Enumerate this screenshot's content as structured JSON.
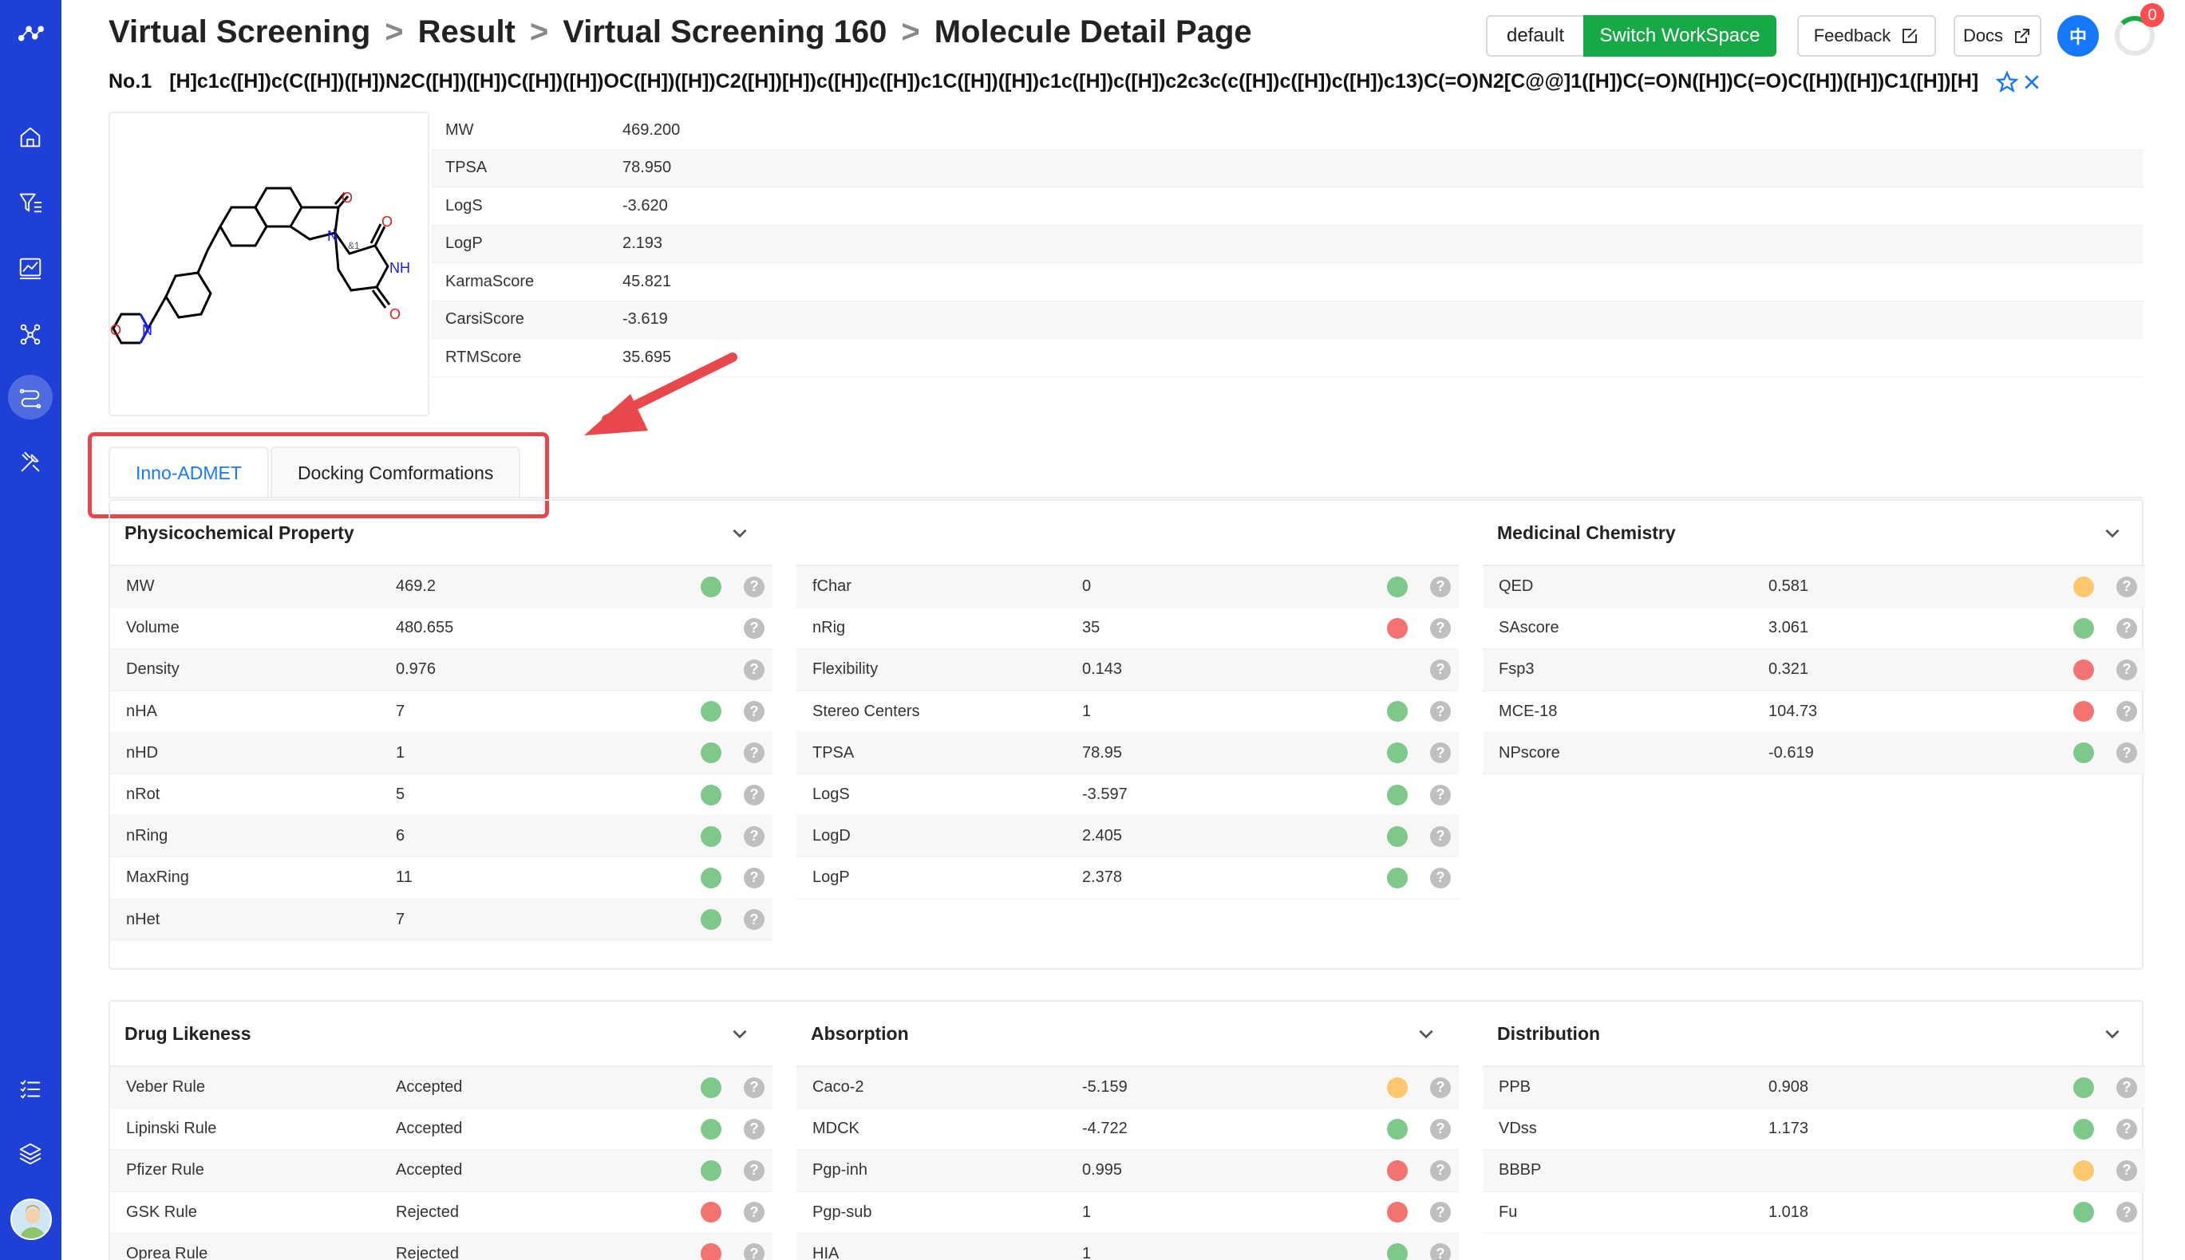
{
  "breadcrumb": [
    "Virtual Screening",
    "Result",
    "Virtual Screening 160",
    "Molecule Detail Page"
  ],
  "breadcrumb_sep": ">",
  "header": {
    "workspace_label": "default",
    "switch_label": "Switch WorkSpace",
    "feedback_label": "Feedback",
    "docs_label": "Docs",
    "lang_label": "中",
    "notif_count": "0"
  },
  "molecule": {
    "number": "No.1",
    "smiles": "[H]c1c([H])c(C([H])([H])N2C([H])([H])C([H])([H])OC([H])([H])C2([H])[H])c([H])c([H])c1C([H])([H])c1c([H])c([H])c2c3c(c([H])c([H])c([H])c13)C(=O)N2[C@@]1([H])C(=O)N([H])C(=O)C([H])([H])C1([H])[H]",
    "atom_labels": {
      "o": "O",
      "n": "N",
      "nh": "NH",
      "stereo": "&1"
    }
  },
  "properties": [
    {
      "key": "MW",
      "value": "469.200"
    },
    {
      "key": "TPSA",
      "value": "78.950"
    },
    {
      "key": "LogS",
      "value": "-3.620"
    },
    {
      "key": "LogP",
      "value": "2.193"
    },
    {
      "key": "KarmaScore",
      "value": "45.821"
    },
    {
      "key": "CarsiScore",
      "value": "-3.619"
    },
    {
      "key": "RTMScore",
      "value": "35.695"
    }
  ],
  "tabs": [
    {
      "label": "Inno-ADMET",
      "active": true
    },
    {
      "label": "Docking Comformations",
      "active": false
    }
  ],
  "sections_top": [
    {
      "title": "Physicochemical Property",
      "collapsible": true,
      "rows": [
        {
          "key": "MW",
          "value": "469.2",
          "status": "green"
        },
        {
          "key": "Volume",
          "value": "480.655",
          "status": ""
        },
        {
          "key": "Density",
          "value": "0.976",
          "status": ""
        },
        {
          "key": "nHA",
          "value": "7",
          "status": "green"
        },
        {
          "key": "nHD",
          "value": "1",
          "status": "green"
        },
        {
          "key": "nRot",
          "value": "5",
          "status": "green"
        },
        {
          "key": "nRing",
          "value": "6",
          "status": "green"
        },
        {
          "key": "MaxRing",
          "value": "11",
          "status": "green"
        },
        {
          "key": "nHet",
          "value": "7",
          "status": "green"
        }
      ]
    },
    {
      "title": "",
      "collapsible": false,
      "rows": [
        {
          "key": "fChar",
          "value": "0",
          "status": "green"
        },
        {
          "key": "nRig",
          "value": "35",
          "status": "red"
        },
        {
          "key": "Flexibility",
          "value": "0.143",
          "status": ""
        },
        {
          "key": "Stereo Centers",
          "value": "1",
          "status": "green"
        },
        {
          "key": "TPSA",
          "value": "78.95",
          "status": "green"
        },
        {
          "key": "LogS",
          "value": "-3.597",
          "status": "green"
        },
        {
          "key": "LogD",
          "value": "2.405",
          "status": "green"
        },
        {
          "key": "LogP",
          "value": "2.378",
          "status": "green"
        }
      ]
    },
    {
      "title": "Medicinal Chemistry",
      "collapsible": true,
      "rows": [
        {
          "key": "QED",
          "value": "0.581",
          "status": "orange"
        },
        {
          "key": "SAscore",
          "value": "3.061",
          "status": "green"
        },
        {
          "key": "Fsp3",
          "value": "0.321",
          "status": "red"
        },
        {
          "key": "MCE-18",
          "value": "104.73",
          "status": "red"
        },
        {
          "key": "NPscore",
          "value": "-0.619",
          "status": "green"
        }
      ]
    }
  ],
  "sections_bottom": [
    {
      "title": "Drug Likeness",
      "collapsible": true,
      "rows": [
        {
          "key": "Veber Rule",
          "value": "Accepted",
          "status": "green"
        },
        {
          "key": "Lipinski Rule",
          "value": "Accepted",
          "status": "green"
        },
        {
          "key": "Pfizer Rule",
          "value": "Accepted",
          "status": "green"
        },
        {
          "key": "GSK Rule",
          "value": "Rejected",
          "status": "red"
        },
        {
          "key": "Oprea Rule",
          "value": "Rejected",
          "status": "red"
        }
      ]
    },
    {
      "title": "Absorption",
      "collapsible": true,
      "rows": [
        {
          "key": "Caco-2",
          "value": "-5.159",
          "status": "orange"
        },
        {
          "key": "MDCK",
          "value": "-4.722",
          "status": "green"
        },
        {
          "key": "Pgp-inh",
          "value": "0.995",
          "status": "red"
        },
        {
          "key": "Pgp-sub",
          "value": "1",
          "status": "red"
        },
        {
          "key": "HIA",
          "value": "1",
          "status": "green"
        }
      ]
    },
    {
      "title": "Distribution",
      "collapsible": true,
      "rows": [
        {
          "key": "PPB",
          "value": "0.908",
          "status": "green"
        },
        {
          "key": "VDss",
          "value": "1.173",
          "status": "green"
        },
        {
          "key": "BBBP",
          "value": "",
          "status": "orange"
        },
        {
          "key": "Fu",
          "value": "1.018",
          "status": "green"
        }
      ]
    }
  ],
  "help_glyph": "?",
  "colors": {
    "sidebar": "#1f40d6",
    "accent": "#1677ff",
    "switch_button": "#18a947",
    "annotation": "#e8474b",
    "status_green": "#7ec88a",
    "status_red": "#f2736f",
    "status_orange": "#fbc86e"
  },
  "sidebar_icons": [
    "logo-icon",
    "home-icon",
    "filter-icon",
    "chart-icon",
    "molecule-icon",
    "route-icon",
    "tools-icon",
    "list-icon",
    "layers-icon"
  ]
}
